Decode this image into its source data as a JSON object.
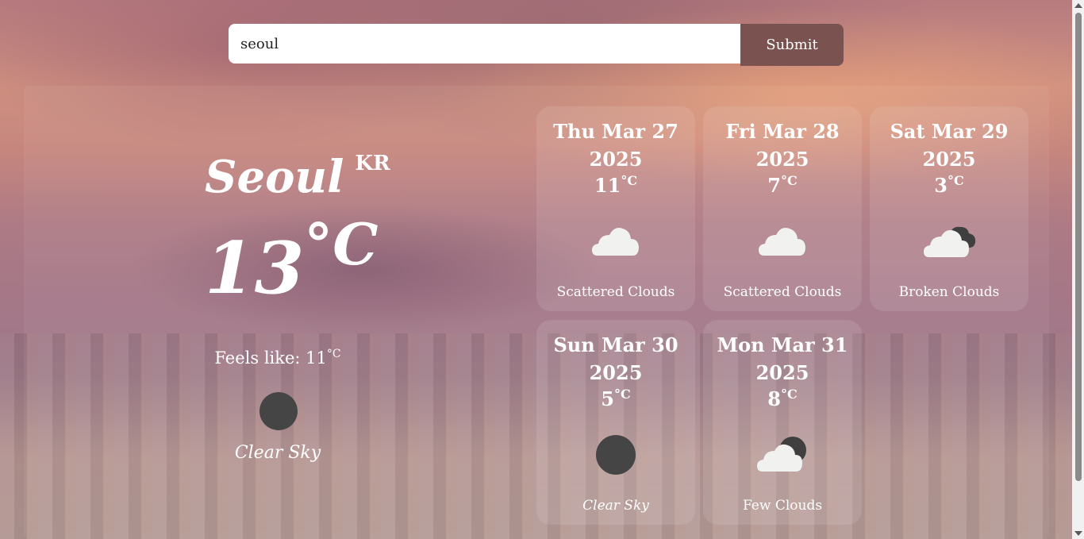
{
  "search": {
    "value": "seoul",
    "submit_label": "Submit"
  },
  "current": {
    "city": "Seoul",
    "country": "KR",
    "temp": "13",
    "temp_unit": "°C",
    "feels_label": "Feels like: 11",
    "feels_unit": "°C",
    "description": "Clear Sky",
    "icon": "clear-sky-icon"
  },
  "forecast": [
    {
      "day": "Thu Mar 27",
      "year": "2025",
      "temp": "11",
      "unit": "°C",
      "description": "Scattered Clouds",
      "icon": "scattered-clouds-icon"
    },
    {
      "day": "Fri Mar 28",
      "year": "2025",
      "temp": "7",
      "unit": "°C",
      "description": "Scattered Clouds",
      "icon": "scattered-clouds-icon"
    },
    {
      "day": "Sat Mar 29",
      "year": "2025",
      "temp": "3",
      "unit": "°C",
      "description": "Broken Clouds",
      "icon": "broken-clouds-icon"
    },
    {
      "day": "Sun Mar 30",
      "year": "2025",
      "temp": "5",
      "unit": "°C",
      "description": "Clear Sky",
      "icon": "clear-sky-icon"
    },
    {
      "day": "Mon Mar 31",
      "year": "2025",
      "temp": "8",
      "unit": "°C",
      "description": "Few Clouds",
      "icon": "few-clouds-icon"
    }
  ]
}
